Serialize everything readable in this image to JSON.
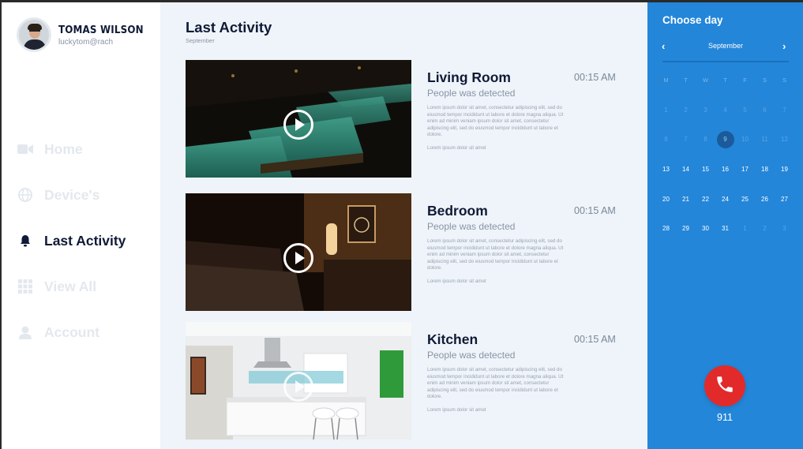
{
  "profile": {
    "name": "TOMAS WILSON",
    "email": "luckytom@rach"
  },
  "nav": [
    {
      "label": "Home",
      "icon": "video-camera-icon",
      "active": false
    },
    {
      "label": "Device's",
      "icon": "globe-icon",
      "active": false
    },
    {
      "label": "Last Activity",
      "icon": "bell-icon",
      "active": true
    },
    {
      "label": "View All",
      "icon": "grid-icon",
      "active": false
    },
    {
      "label": "Account",
      "icon": "user-icon",
      "active": false
    }
  ],
  "main": {
    "title": "Last Activity",
    "subtitle": "September",
    "cards": [
      {
        "title": "Living Room",
        "time": "00:15 AM",
        "status": "People was detected",
        "desc": "Lorem ipsum dolor sit amet, consectetur adipiscing elit, sed do eiusmod tempor incididunt ut labore et dolore magna aliqua. Ut enim ad minim veniam ipsum dolor sit amet, consectetur adipiscing elit, sed do eiusmod tempor incididunt ut labore et dolore.",
        "foot": "Lorem ipsum dolor sit amet"
      },
      {
        "title": "Bedroom",
        "time": "00:15 AM",
        "status": "People was detected",
        "desc": "Lorem ipsum dolor sit amet, consectetur adipiscing elit, sed do eiusmod tempor incididunt ut labore et dolore magna aliqua. Ut enim ad minim veniam ipsum dolor sit amet, consectetur adipiscing elit, sed do eiusmod tempor incididunt ut labore et dolore.",
        "foot": "Lorem ipsum dolor sit amet"
      },
      {
        "title": "Kitchen",
        "time": "00:15 AM",
        "status": "People was detected",
        "desc": "Lorem ipsum dolor sit amet, consectetur adipiscing elit, sed do eiusmod tempor incididunt ut labore et dolore magna aliqua. Ut enim ad minim veniam ipsum dolor sit amet, consectetur adipiscing elit, sed do eiusmod tempor incididunt ut labore et dolore.",
        "foot": "Lorem ipsum dolor sit amet"
      }
    ]
  },
  "calendar": {
    "title": "Choose day",
    "month": "September",
    "prev_icon": "chevron-left-icon",
    "next_icon": "chevron-right-icon",
    "weekdays": [
      "M",
      "T",
      "W",
      "T",
      "F",
      "S",
      "S"
    ],
    "weeks": [
      [
        "1",
        "2",
        "3",
        "4",
        "5",
        "6",
        "7"
      ],
      [
        "8",
        "7",
        "8",
        "9",
        "10",
        "11",
        "12"
      ],
      [
        "13",
        "14",
        "15",
        "16",
        "17",
        "18",
        "19"
      ],
      [
        "20",
        "21",
        "22",
        "24",
        "25",
        "26",
        "27"
      ],
      [
        "28",
        "29",
        "30",
        "31",
        "1",
        "2",
        "3"
      ]
    ],
    "selected_day": "9",
    "emergency_label": "911"
  },
  "colors": {
    "accent": "#2386d9",
    "navy": "#101a36",
    "call": "#e22a2a",
    "selected_day": "#1b5b9b"
  }
}
